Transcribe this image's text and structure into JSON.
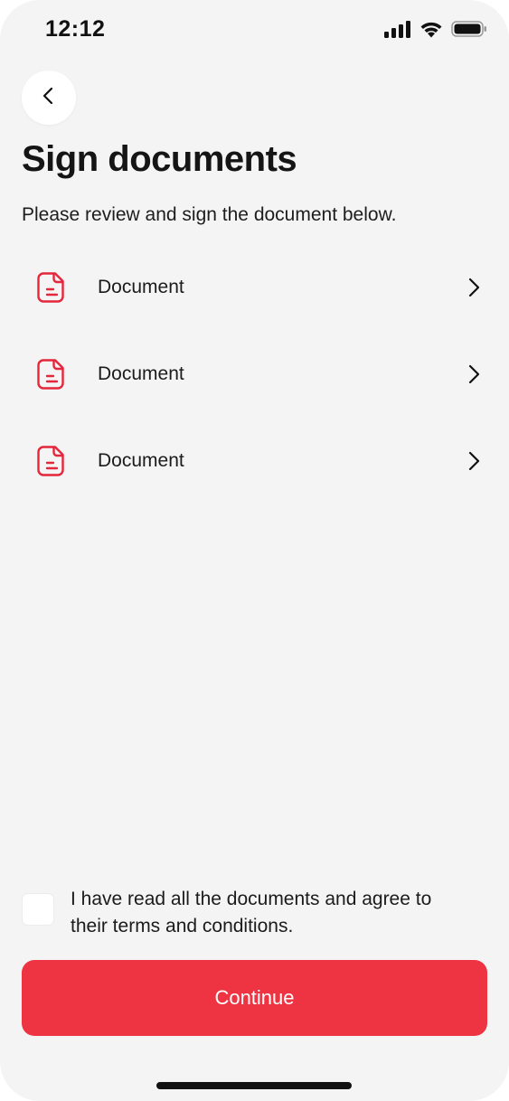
{
  "status_bar": {
    "time": "12:12",
    "icons": [
      "cellular-signal-icon",
      "wifi-icon",
      "battery-icon"
    ]
  },
  "header": {
    "back_icon": "chevron-left-icon",
    "title": "Sign documents",
    "subtitle": "Please review and sign the document below."
  },
  "documents": [
    {
      "label": "Document",
      "icon": "document-icon",
      "action_icon": "chevron-right-icon"
    },
    {
      "label": "Document",
      "icon": "document-icon",
      "action_icon": "chevron-right-icon"
    },
    {
      "label": "Document",
      "icon": "document-icon",
      "action_icon": "chevron-right-icon"
    }
  ],
  "agreement": {
    "checked": false,
    "text": "I have read all the documents and agree to their terms and conditions."
  },
  "footer": {
    "continue_label": "Continue"
  },
  "colors": {
    "accent": "#ee3342",
    "background": "#f4f4f5",
    "text": "#161616"
  }
}
